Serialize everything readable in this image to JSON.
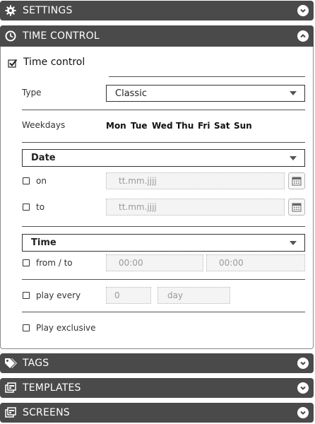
{
  "sections": {
    "settings": "SETTINGS",
    "time_control": "TIME CONTROL",
    "tags": "TAGS",
    "templates": "TEMPLATES",
    "screens": "SCREENS"
  },
  "time_control": {
    "enabled_label": "Time control",
    "enabled": true,
    "type_label": "Type",
    "type_value": "Classic",
    "weekdays_label": "Weekdays",
    "weekdays": [
      "Mon",
      "Tue",
      "Wed",
      "Thu",
      "Fri",
      "Sat",
      "Sun"
    ],
    "date": {
      "header": "Date",
      "on_label": "on",
      "to_label": "to",
      "on_placeholder": "tt.mm.jjjj",
      "to_placeholder": "tt.mm.jjjj"
    },
    "time": {
      "header": "Time",
      "from_to_label": "from / to",
      "from_value": "00:00",
      "to_value": "00:00",
      "play_every_label": "play every",
      "play_every_value": "0",
      "play_every_unit": "day",
      "play_exclusive_label": "Play exclusive"
    }
  },
  "colors": {
    "section_bar": "#4a4a4a",
    "input_bg": "#f4f4f4",
    "placeholder": "#9a9a9a"
  }
}
